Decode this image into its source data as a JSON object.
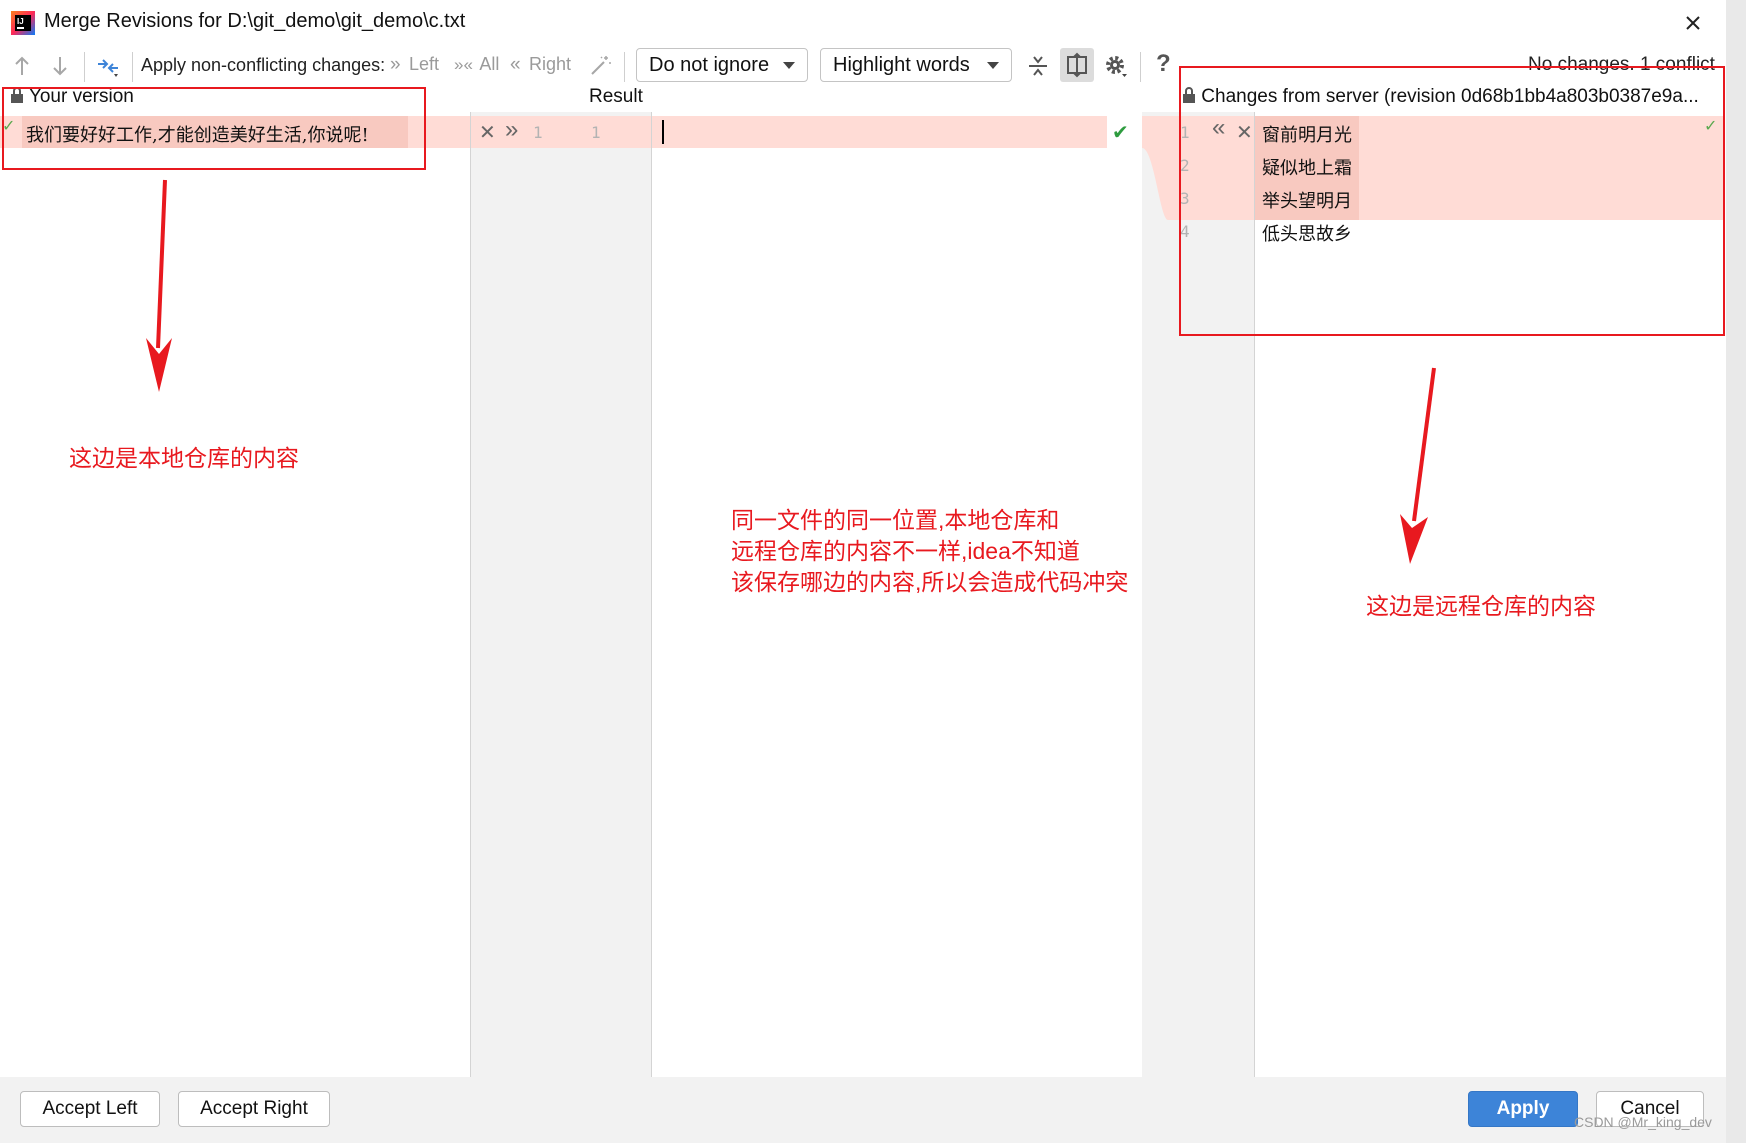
{
  "window": {
    "title": "Merge Revisions for D:\\git_demo\\git_demo\\c.txt",
    "close_glyph": "✕"
  },
  "toolbar": {
    "prev_icon": "arrow-up-icon",
    "next_icon": "arrow-down-icon",
    "apply_label": "Apply non-conflicting changes:",
    "left_label": "Left",
    "all_label": "All",
    "right_label": "Right",
    "ignore_option": "Do not ignore",
    "highlight_option": "Highlight words",
    "help_glyph": "?",
    "status": "No changes. 1 conflict"
  },
  "panes": {
    "left_header": "Your version",
    "result_header": "Result",
    "right_header": "Changes from server (revision 0d68b1bb4a803b0387e9a..."
  },
  "left_lines": [
    "我们要好好工作,才能创造美好生活,你说呢!"
  ],
  "result_lines": [
    ""
  ],
  "gutter_left_line": "1",
  "result_line_number": "1",
  "right_lines": [
    {
      "no": "1",
      "text": "窗前明月光"
    },
    {
      "no": "2",
      "text": "疑似地上霜"
    },
    {
      "no": "3",
      "text": "举头望明月"
    },
    {
      "no": "4",
      "text": "低头思故乡"
    }
  ],
  "buttons": {
    "accept_left": "Accept Left",
    "accept_right": "Accept Right",
    "apply": "Apply",
    "cancel": "Cancel"
  },
  "annotations": {
    "left_note": "这边是本地仓库的内容",
    "middle_note_1": "同一文件的同一位置,本地仓库和",
    "middle_note_2": "远程仓库的内容不一样,idea不知道",
    "middle_note_3": "该保存哪边的内容,所以会造成代码冲突",
    "right_note": "这边是远程仓库的内容",
    "annotation_color": "#e8191f"
  },
  "colors": {
    "conflict": "#ffdcd6",
    "accent": "#3d84d8"
  },
  "watermark": "CSDN @Mr_king_dev"
}
